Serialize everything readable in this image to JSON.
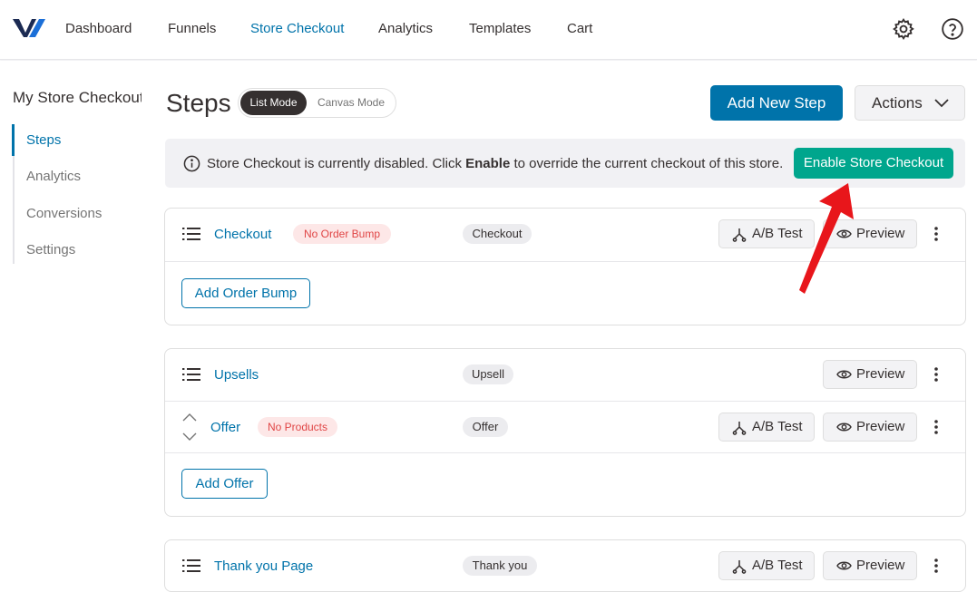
{
  "nav": {
    "items": [
      "Dashboard",
      "Funnels",
      "Store Checkout",
      "Analytics",
      "Templates",
      "Cart"
    ],
    "active": "Store Checkout",
    "right_icons": [
      "gear-icon",
      "help-icon"
    ]
  },
  "sidebar": {
    "title": "My Store Checkout",
    "items": [
      "Steps",
      "Analytics",
      "Conversions",
      "Settings"
    ],
    "active": "Steps"
  },
  "page": {
    "title": "Steps",
    "mode_active": "List Mode",
    "mode_inactive": "Canvas Mode",
    "add_button": "Add New Step",
    "actions_button": "Actions"
  },
  "notice": {
    "text_before": "Store Checkout is currently disabled. Click ",
    "text_bold": "Enable",
    "text_after": " to override the current checkout of this store.",
    "button": "Enable Store Checkout"
  },
  "cards": {
    "checkout": {
      "name": "Checkout",
      "warning": "No Order Bump",
      "type": "Checkout",
      "ab_test": "A/B Test",
      "preview": "Preview",
      "add_button": "Add Order Bump"
    },
    "upsells": {
      "name": "Upsells",
      "type": "Upsell",
      "preview": "Preview",
      "offer": {
        "name": "Offer",
        "warning": "No Products",
        "type": "Offer",
        "ab_test": "A/B Test",
        "preview": "Preview"
      },
      "add_button": "Add Offer"
    },
    "thankyou": {
      "name": "Thank you Page",
      "type": "Thank you",
      "ab_test": "A/B Test",
      "preview": "Preview"
    }
  },
  "colors": {
    "primary": "#0073aa",
    "enable": "#00a68d",
    "warning_text": "#e04545",
    "arrow": "#e8161b"
  }
}
